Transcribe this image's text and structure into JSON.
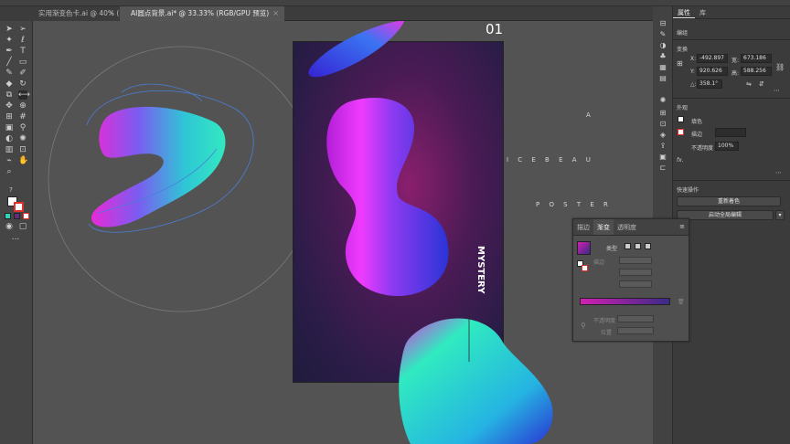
{
  "app": {
    "doc_tabs": [
      {
        "label": "实用渐变色卡.ai @ 40% (RGB/GPU 预览)",
        "active": false
      },
      {
        "label": "AI圆点背景.ai* @ 33.33% (RGB/GPU 预览)",
        "active": true
      }
    ]
  },
  "toolbar": {
    "icons": [
      "select-icon",
      "direct-select-icon",
      "magic-wand-icon",
      "lasso-icon",
      "pen-icon",
      "type-icon",
      "line-icon",
      "rectangle-icon",
      "paintbrush-icon",
      "pencil-icon",
      "eraser-icon",
      "rotate-icon",
      "scale-icon",
      "width-icon",
      "free-transform-icon",
      "shape-builder-icon",
      "perspective-icon",
      "mesh-icon",
      "gradient-icon",
      "eyedropper-icon",
      "blend-icon",
      "symbol-sprayer-icon",
      "graph-icon",
      "artboard-icon",
      "slice-icon",
      "hand-icon",
      "zoom-icon"
    ],
    "fill_color": "#ffffff",
    "stroke_color": "#e0302a",
    "more_label": "..."
  },
  "artboard": {
    "number": "01",
    "letters_a": "A",
    "icebeau": "I C E B E A U",
    "poster": "P O S T E R",
    "mystery": "MYSTERY",
    "small_caption": "—— ——"
  },
  "properties": {
    "tabs": [
      "属性",
      "库"
    ],
    "section_group": "编组",
    "section_transform": "变换",
    "x_label": "X:",
    "x_value": "-492.897",
    "y_label": "Y:",
    "y_value": "920.626",
    "w_label": "宽:",
    "w_value": "673.186",
    "h_label": "高:",
    "h_value": "588.256",
    "angle_label": "△:",
    "angle_value": "358.1°",
    "section_appearance": "外观",
    "fill_label": "填色",
    "stroke_label": "描边",
    "opacity_label": "不透明度",
    "opacity_value": "100%",
    "fx_label": "fx.",
    "section_quick": "快速操作",
    "recolor_btn": "重新着色",
    "global_edit_btn": "启动全局编辑"
  },
  "gradient_panel": {
    "tabs": [
      "描边",
      "渐变",
      "透明度"
    ],
    "active_tab": "渐变",
    "type_label": "类型",
    "stroke_label": "描边",
    "opacity_label": "不透明度",
    "location_label": "位置",
    "gradient_from": "#d21fb2",
    "gradient_to": "#3a2a86"
  },
  "colors": {
    "ui_bg": "#535353",
    "panel_bg": "#3b3b3b",
    "accent_selection": "#4a7fd8"
  }
}
